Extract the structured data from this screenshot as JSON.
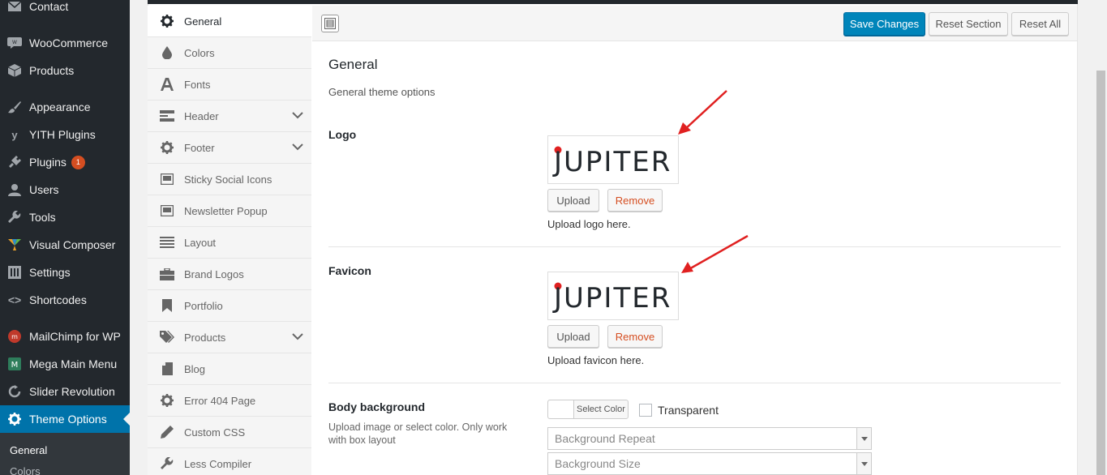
{
  "wp_menu": {
    "items": [
      {
        "label": "Contact",
        "icon": "mail-icon"
      },
      {
        "label": "WooCommerce",
        "icon": "woo-icon"
      },
      {
        "label": "Products",
        "icon": "box-icon"
      },
      {
        "label": "Appearance",
        "icon": "brush-icon"
      },
      {
        "label": "YITH Plugins",
        "icon": "yith-icon"
      },
      {
        "label": "Plugins",
        "icon": "plug-icon",
        "badge": "1"
      },
      {
        "label": "Users",
        "icon": "user-icon"
      },
      {
        "label": "Tools",
        "icon": "wrench-icon"
      },
      {
        "label": "Visual Composer",
        "icon": "vc-icon"
      },
      {
        "label": "Settings",
        "icon": "sliders-icon"
      },
      {
        "label": "Shortcodes",
        "icon": "code-icon"
      },
      {
        "label": "MailChimp for WP",
        "icon": "mailchimp-icon"
      },
      {
        "label": "Mega Main Menu",
        "icon": "mega-icon"
      },
      {
        "label": "Slider Revolution",
        "icon": "refresh-icon"
      },
      {
        "label": "Theme Options",
        "icon": "gear-icon"
      }
    ],
    "submenu": [
      "General",
      "Colors"
    ]
  },
  "options_nav": [
    {
      "label": "General",
      "icon": "gear-icon",
      "active": true
    },
    {
      "label": "Colors",
      "icon": "drop-icon"
    },
    {
      "label": "Fonts",
      "icon": "font-icon"
    },
    {
      "label": "Header",
      "icon": "header-icon",
      "expandable": true
    },
    {
      "label": "Footer",
      "icon": "gear-icon",
      "expandable": true
    },
    {
      "label": "Sticky Social Icons",
      "icon": "window-icon"
    },
    {
      "label": "Newsletter Popup",
      "icon": "window-icon"
    },
    {
      "label": "Layout",
      "icon": "list-icon"
    },
    {
      "label": "Brand Logos",
      "icon": "briefcase-icon"
    },
    {
      "label": "Portfolio",
      "icon": "bookmark-icon"
    },
    {
      "label": "Products",
      "icon": "tag-icon",
      "expandable": true
    },
    {
      "label": "Blog",
      "icon": "document-icon"
    },
    {
      "label": "Error 404 Page",
      "icon": "gear-icon"
    },
    {
      "label": "Custom CSS",
      "icon": "pencil-icon"
    },
    {
      "label": "Less Compiler",
      "icon": "wrench-icon"
    }
  ],
  "toolbar": {
    "save": "Save Changes",
    "reset_section": "Reset Section",
    "reset_all": "Reset All"
  },
  "section": {
    "title": "General",
    "description": "General theme options"
  },
  "logo": {
    "label": "Logo",
    "image_text": "JUPITER",
    "upload": "Upload",
    "remove": "Remove",
    "help": "Upload logo here."
  },
  "favicon": {
    "label": "Favicon",
    "image_text": "JUPITER",
    "upload": "Upload",
    "remove": "Remove",
    "help": "Upload favicon here."
  },
  "body_background": {
    "label": "Body background",
    "description": "Upload image or select color. Only work with box layout",
    "select_color": "Select Color",
    "transparent": "Transparent",
    "repeat_placeholder": "Background Repeat",
    "size_placeholder": "Background Size"
  },
  "colors": {
    "accent": "#0085ba",
    "arrow": "#e02020",
    "remove": "#d54e21"
  }
}
